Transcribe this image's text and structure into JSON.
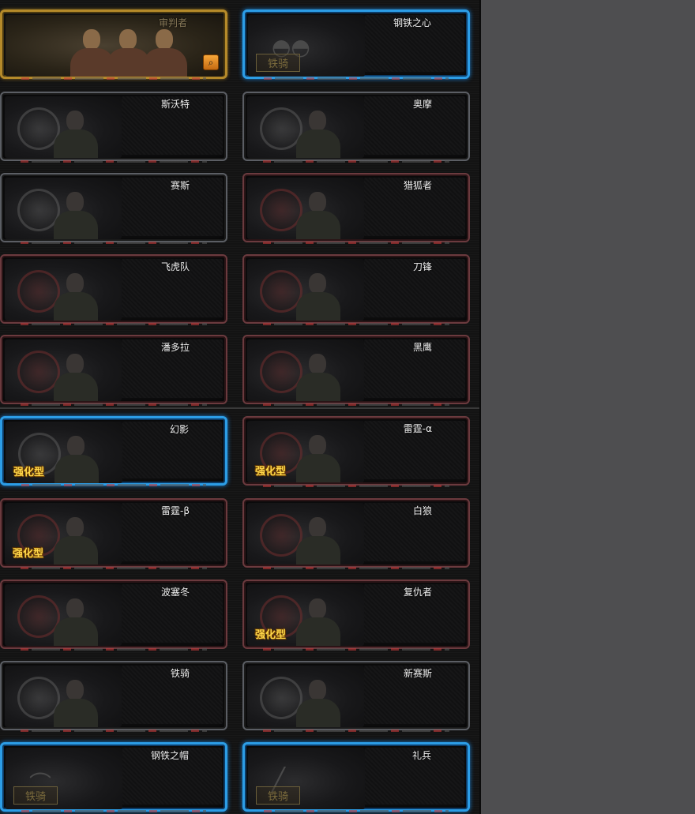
{
  "characters": [
    {
      "name": "审判者",
      "frame": "gold",
      "badge": "",
      "icon": "group-portrait"
    },
    {
      "name": "钢铁之心",
      "frame": "blue",
      "badge": "铁骑",
      "icon": "sunglasses-icon"
    },
    {
      "name": "斯沃特",
      "frame": "gray",
      "badge": "",
      "icon": "soldier"
    },
    {
      "name": "奥摩",
      "frame": "gray",
      "badge": "",
      "icon": "soldier"
    },
    {
      "name": "赛斯",
      "frame": "gray",
      "badge": "",
      "icon": "soldier"
    },
    {
      "name": "猎狐者",
      "frame": "red",
      "badge": "",
      "icon": "soldier"
    },
    {
      "name": "飞虎队",
      "frame": "red",
      "badge": "",
      "icon": "soldier"
    },
    {
      "name": "刀锋",
      "frame": "red",
      "badge": "",
      "icon": "soldier"
    },
    {
      "name": "潘多拉",
      "frame": "red",
      "badge": "",
      "icon": "soldier"
    },
    {
      "name": "黑鹰",
      "frame": "red",
      "badge": "",
      "icon": "soldier"
    },
    {
      "name": "幻影",
      "frame": "blue",
      "badge": "强化型",
      "icon": "soldier"
    },
    {
      "name": "雷霆-α",
      "frame": "red",
      "badge": "强化型",
      "icon": "soldier"
    },
    {
      "name": "雷霆-β",
      "frame": "red",
      "badge": "强化型",
      "icon": "soldier"
    },
    {
      "name": "白狼",
      "frame": "red",
      "badge": "",
      "icon": "soldier"
    },
    {
      "name": "波塞冬",
      "frame": "red",
      "badge": "",
      "icon": "soldier"
    },
    {
      "name": "复仇者",
      "frame": "red",
      "badge": "强化型",
      "icon": "soldier"
    },
    {
      "name": "铁骑",
      "frame": "gray",
      "badge": "",
      "icon": "soldier"
    },
    {
      "name": "新赛斯",
      "frame": "gray",
      "badge": "",
      "icon": "soldier"
    },
    {
      "name": "钢铁之帽",
      "frame": "blue",
      "badge": "铁骑",
      "icon": "helmet-icon"
    },
    {
      "name": "礼兵",
      "frame": "blue",
      "badge": "铁骑",
      "icon": "weapon-icon"
    }
  ],
  "colors": {
    "blue_frame": "#2c9de6",
    "red_frame": "#6b3a3e",
    "gold_frame": "#b58a2a",
    "gray_frame": "#5b5e64"
  }
}
